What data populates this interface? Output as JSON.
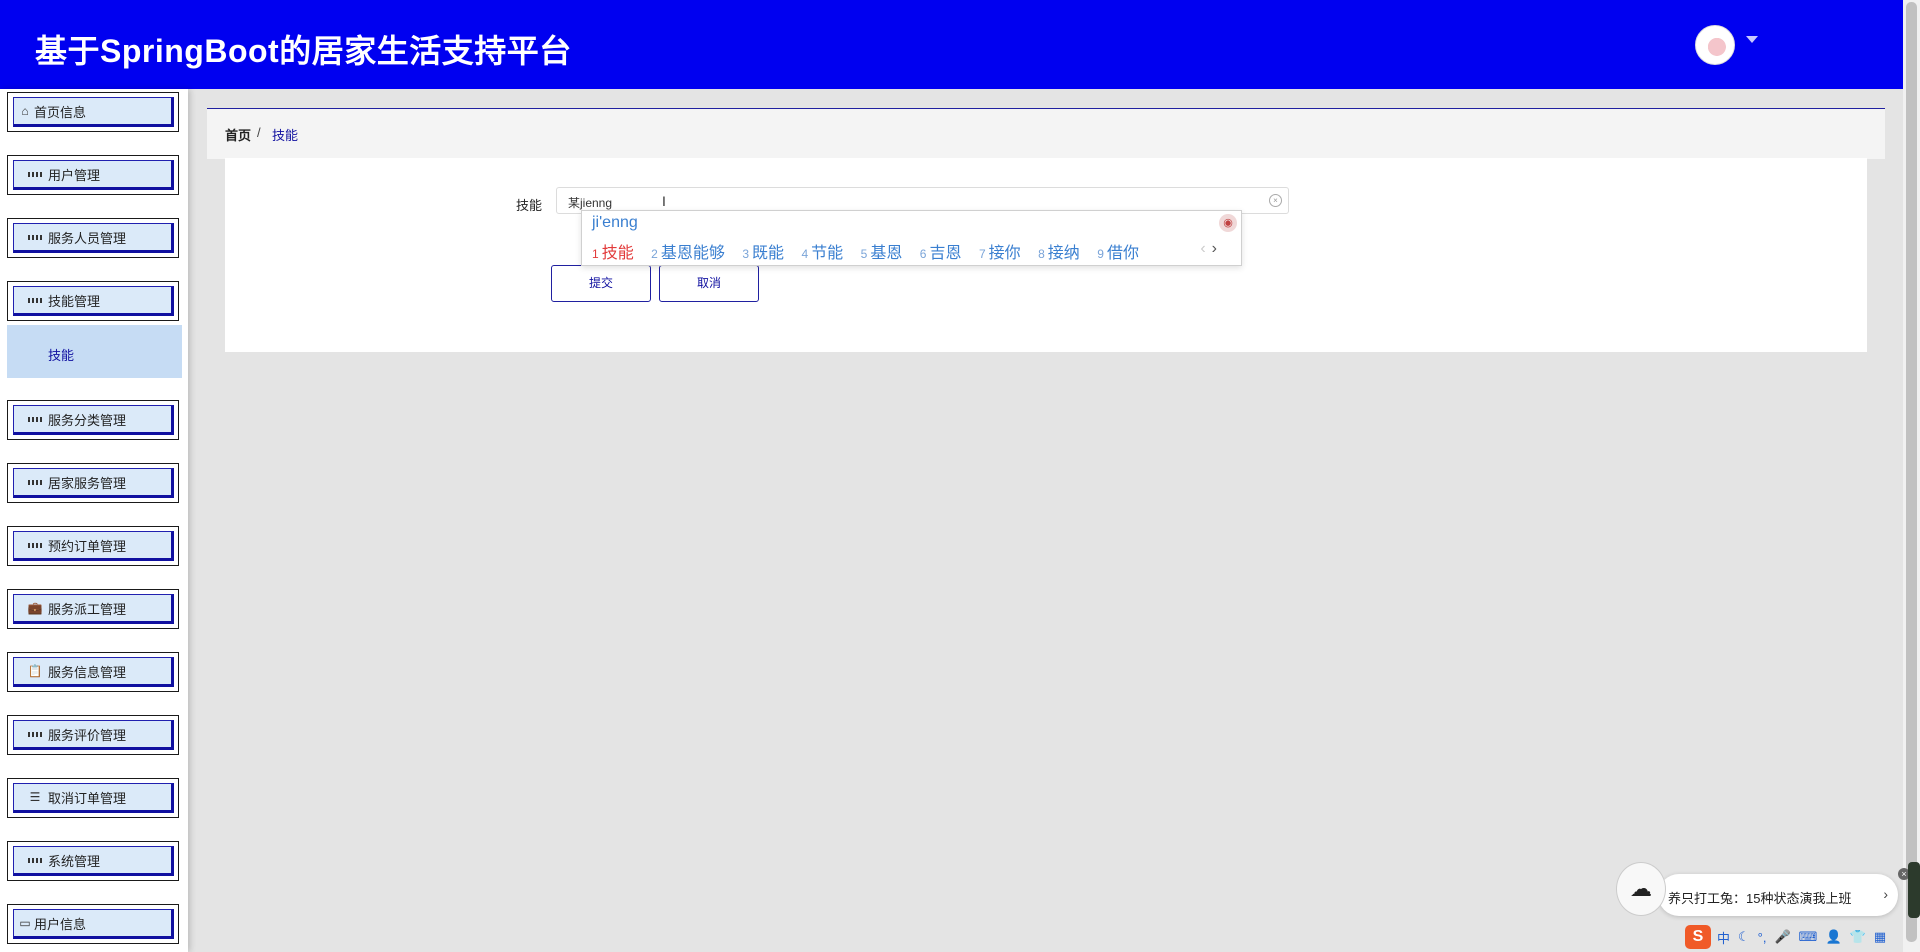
{
  "header": {
    "title": "基于SpringBoot的居家生活支持平台",
    "avatar_icon": "user-avatar",
    "dropdown_icon": "caret-down-icon"
  },
  "sidebar": {
    "items": [
      {
        "label": "首页信息",
        "icon": "home-icon"
      },
      {
        "label": "用户管理",
        "icon": "grid-icon"
      },
      {
        "label": "服务人员管理",
        "icon": "grid-icon"
      },
      {
        "label": "技能管理",
        "icon": "grid-icon"
      },
      {
        "label": "服务分类管理",
        "icon": "grid-icon"
      },
      {
        "label": "居家服务管理",
        "icon": "grid-icon"
      },
      {
        "label": "预约订单管理",
        "icon": "grid-icon"
      },
      {
        "label": "服务派工管理",
        "icon": "briefcase-icon"
      },
      {
        "label": "服务信息管理",
        "icon": "clipboard-icon"
      },
      {
        "label": "服务评价管理",
        "icon": "grid-icon"
      },
      {
        "label": "取消订单管理",
        "icon": "sliders-icon"
      },
      {
        "label": "系统管理",
        "icon": "grid-icon"
      },
      {
        "label": "用户信息",
        "icon": "card-icon"
      }
    ],
    "submenu": {
      "label": "技能"
    }
  },
  "breadcrumb": {
    "home": "首页",
    "separator": "/",
    "current": "技能"
  },
  "form": {
    "field_label": "技能",
    "input_value": "某jienng",
    "submit_label": "提交",
    "cancel_label": "取消"
  },
  "ime": {
    "pinyin": "ji'enng",
    "candidates": [
      {
        "n": "1",
        "text": "技能"
      },
      {
        "n": "2",
        "text": "基恩能够"
      },
      {
        "n": "3",
        "text": "既能"
      },
      {
        "n": "4",
        "text": "节能"
      },
      {
        "n": "5",
        "text": "基恩"
      },
      {
        "n": "6",
        "text": "吉恩"
      },
      {
        "n": "7",
        "text": "接你"
      },
      {
        "n": "8",
        "text": "接纳"
      },
      {
        "n": "9",
        "text": "借你"
      }
    ],
    "prev": "‹",
    "next": "›"
  },
  "toast": {
    "message": "养只打工兔：15种状态演我上班",
    "chevron": "›",
    "close": "×"
  },
  "sogou_bar": {
    "logo": "S",
    "mode": "中",
    "items": [
      "☾",
      "°,",
      "🎤",
      "⌨",
      "👤",
      "👕",
      "▦"
    ]
  },
  "colors": {
    "header_bg": "#0000f0",
    "accent": "#1010a0",
    "menu_bg": "#dbeaf9",
    "ime_first": "#e23a3a",
    "ime_cand": "#3a7fd0"
  }
}
